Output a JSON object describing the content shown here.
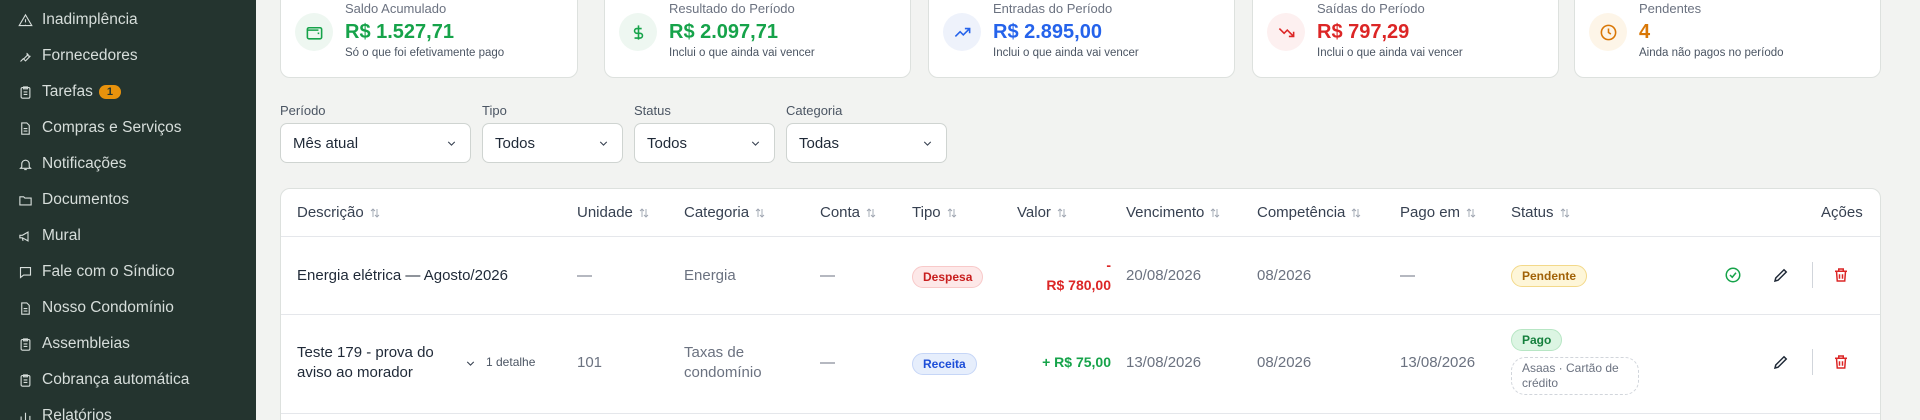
{
  "sidebar": {
    "items": [
      {
        "label": "Inadimplência",
        "icon": "warning-icon"
      },
      {
        "label": "Fornecedores",
        "icon": "wrench-icon"
      },
      {
        "label": "Tarefas",
        "icon": "clipboard-icon",
        "badge": "1"
      },
      {
        "label": "Compras e Serviços",
        "icon": "document-icon"
      },
      {
        "label": "Notificações",
        "icon": "bell-icon"
      },
      {
        "label": "Documentos",
        "icon": "folder-icon"
      },
      {
        "label": "Mural",
        "icon": "megaphone-icon"
      },
      {
        "label": "Fale com o Síndico",
        "icon": "chat-icon"
      },
      {
        "label": "Nosso Condomínio",
        "icon": "document-icon"
      },
      {
        "label": "Assembleias",
        "icon": "clipboard-icon"
      },
      {
        "label": "Cobrança automática",
        "icon": "clipboard-icon"
      },
      {
        "label": "Relatórios",
        "icon": "chart-icon"
      }
    ]
  },
  "cards": [
    {
      "label": "Saldo Acumulado",
      "value": "R$ 1.527,71",
      "sub": "Só o que foi efetivamente pago",
      "icon": "wallet-icon",
      "color": "#16a34a"
    },
    {
      "label": "Resultado do Período",
      "value": "R$ 2.097,71",
      "sub": "Inclui o que ainda vai vencer",
      "icon": "dollar-icon",
      "color": "#16a34a"
    },
    {
      "label": "Entradas do Período",
      "value": "R$ 2.895,00",
      "sub": "Inclui o que ainda vai vencer",
      "icon": "trending-up-icon",
      "color": "#2563eb"
    },
    {
      "label": "Saídas do Período",
      "value": "R$ 797,29",
      "sub": "Inclui o que ainda vai vencer",
      "icon": "trending-down-icon",
      "color": "#dc2626"
    },
    {
      "label": "Pendentes",
      "value": "4",
      "sub": "Ainda não pagos no período",
      "icon": "clock-icon",
      "color": "#d97706"
    }
  ],
  "filters": {
    "period": {
      "label": "Período",
      "value": "Mês atual"
    },
    "type": {
      "label": "Tipo",
      "value": "Todos"
    },
    "status": {
      "label": "Status",
      "value": "Todos"
    },
    "category": {
      "label": "Categoria",
      "value": "Todas"
    }
  },
  "table": {
    "headers": {
      "description": "Descrição",
      "unit": "Unidade",
      "category": "Categoria",
      "account": "Conta",
      "type": "Tipo",
      "value": "Valor",
      "due": "Vencimento",
      "competence": "Competência",
      "paid": "Pago em",
      "status": "Status",
      "actions": "Ações"
    },
    "rows": [
      {
        "description": "Energia elétrica — Agosto/2026",
        "unit": "—",
        "category": "Energia",
        "account": "—",
        "type": "Despesa",
        "value_sign": "-",
        "value": "R$ 780,00",
        "due": "20/08/2026",
        "competence": "08/2026",
        "paid": "—",
        "status": "Pendente"
      },
      {
        "description_l1": "Teste 179 - prova do",
        "description_l2": "aviso ao morador",
        "detail": "1 detalhe",
        "unit": "101",
        "category_l1": "Taxas de",
        "category_l2": "condomínio",
        "account": "—",
        "type": "Receita",
        "value": "+ R$ 75,00",
        "due": "13/08/2026",
        "competence": "08/2026",
        "paid": "13/08/2026",
        "status": "Pago",
        "payment_l1": "Asaas · Cartão de",
        "payment_l2": "crédito"
      }
    ]
  }
}
